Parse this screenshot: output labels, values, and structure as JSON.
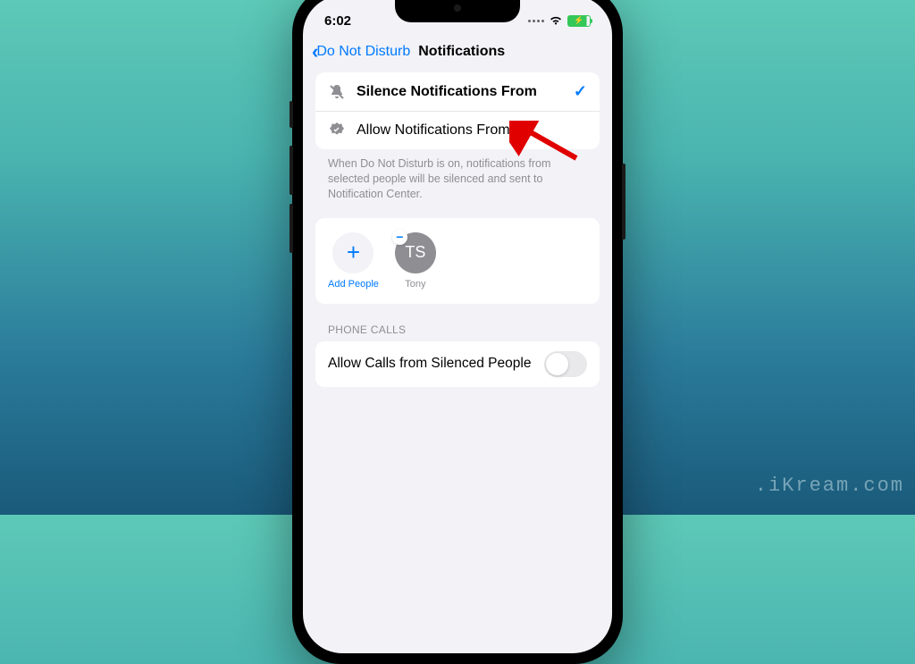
{
  "status": {
    "time": "6:02"
  },
  "nav": {
    "back_label": "Do Not Disturb",
    "title": "Notifications"
  },
  "options": {
    "silence": {
      "label": "Silence Notifications From",
      "selected": true
    },
    "allow": {
      "label": "Allow Notifications From",
      "selected": false
    }
  },
  "footer": "When Do Not Disturb is on, notifications from selected people will be silenced and sent to Notification Center.",
  "people": {
    "add_label": "Add People",
    "items": [
      {
        "initials": "TS",
        "name": "Tony"
      }
    ]
  },
  "sections": {
    "phone_calls": {
      "header": "PHONE CALLS",
      "allow_silenced": "Allow Calls from Silenced People",
      "toggle_on": false
    }
  },
  "watermark": ".iKream.com"
}
